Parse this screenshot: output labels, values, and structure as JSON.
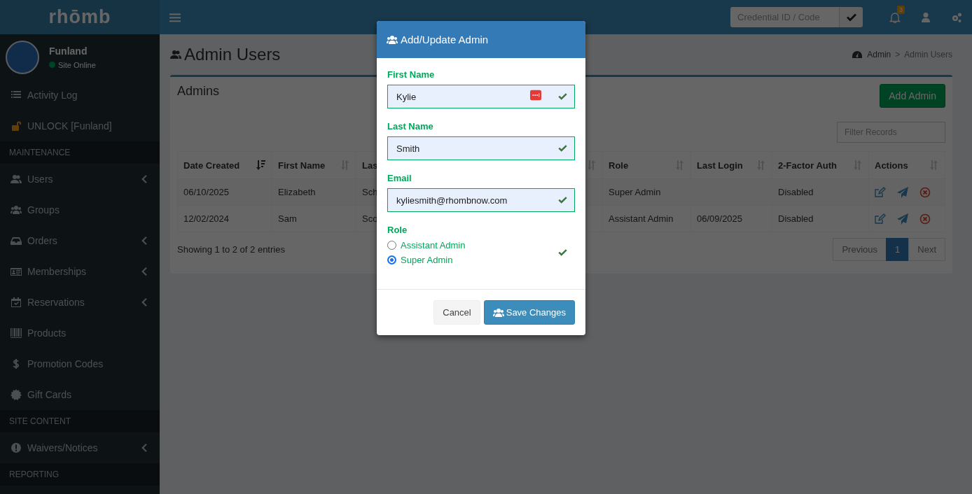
{
  "brand": "rhōmb",
  "sidebar": {
    "site": {
      "name": "Funland",
      "status": "Site Online",
      "online": true
    },
    "items": [
      {
        "kind": "link",
        "label": "Activity Log",
        "submenu": false
      },
      {
        "kind": "link",
        "label": "UNLOCK [Funland]",
        "submenu": false
      },
      {
        "kind": "header",
        "label": "MAINTENANCE"
      },
      {
        "kind": "link",
        "label": "Users",
        "submenu": true
      },
      {
        "kind": "link",
        "label": "Groups",
        "submenu": false
      },
      {
        "kind": "link",
        "label": "Orders",
        "submenu": true
      },
      {
        "kind": "link",
        "label": "Memberships",
        "submenu": true
      },
      {
        "kind": "link",
        "label": "Reservations",
        "submenu": true
      },
      {
        "kind": "link",
        "label": "Products",
        "submenu": false
      },
      {
        "kind": "link",
        "label": "Promotion Codes",
        "submenu": false
      },
      {
        "kind": "link",
        "label": "Gift Cards",
        "submenu": false
      },
      {
        "kind": "header",
        "label": "SITE CONTENT"
      },
      {
        "kind": "link",
        "label": "Waivers/Notices",
        "submenu": true
      },
      {
        "kind": "header",
        "label": "REPORTING"
      }
    ]
  },
  "topbar": {
    "credential": {
      "placeholder": "Credential ID / Code"
    },
    "notifications": "3"
  },
  "page": {
    "title": "Admin Users",
    "breadcrumb": [
      "Admin",
      "Admin Users"
    ],
    "breadcrumb_separator": ">"
  },
  "box": {
    "title": "Admins",
    "add_button": "Add Admin",
    "filter": {
      "placeholder": "Filter Records"
    },
    "table": {
      "columns": [
        {
          "label": "Date Created",
          "sorted": true
        },
        {
          "label": "First Name",
          "sorted": false
        },
        {
          "label": "Las",
          "sorted": false
        },
        {
          "label": "Role",
          "sorted": false
        },
        {
          "label": "Last Login",
          "sorted": false
        },
        {
          "label": "2-Factor Auth",
          "sorted": false
        },
        {
          "label": "Actions",
          "sorted": false
        }
      ],
      "rows": [
        {
          "cells": [
            "06/10/2025",
            "Elizabeth",
            "Sch",
            "Super Admin",
            "",
            "Disabled"
          ]
        },
        {
          "cells": [
            "12/02/2024",
            "Sam",
            "Sco",
            "Assistant Admin",
            "06/09/2025",
            "Disabled"
          ]
        }
      ]
    },
    "info": "Showing 1 to 2 of 2 entries",
    "pagination": [
      {
        "label": "Previous",
        "selected": false
      },
      {
        "label": "1",
        "selected": true
      },
      {
        "label": "Next",
        "selected": false
      }
    ]
  },
  "modal": {
    "title": "Add/Update Admin",
    "fields": [
      {
        "label": "First Name",
        "value": "Kylie",
        "valid": true,
        "password_manager": true
      },
      {
        "label": "Last Name",
        "value": "Smith",
        "valid": true,
        "password_manager": false
      },
      {
        "label": "Email",
        "value": "kyliesmith@rhombnow.com",
        "valid": true,
        "password_manager": false
      }
    ],
    "role": {
      "label": "Role",
      "valid": true,
      "options": [
        {
          "label": "Assistant Admin",
          "selected": false
        },
        {
          "label": "Super Admin",
          "selected": true
        }
      ]
    },
    "buttons": [
      {
        "label": "Cancel",
        "kind": "default"
      },
      {
        "label": "Save Changes",
        "kind": "primary"
      }
    ]
  }
}
